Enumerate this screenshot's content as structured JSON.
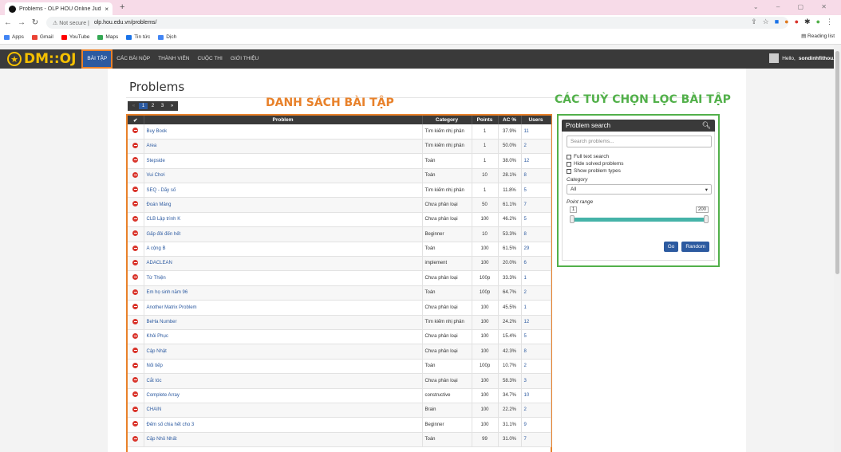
{
  "browser": {
    "tab_title": "Problems - OLP HOU Online Jud",
    "tab_close": "×",
    "new_tab": "+",
    "window_controls": "⌄ – ▢ ✕",
    "not_secure": "Not secure",
    "url": "olp.hou.edu.vn/problems/",
    "bookmarks": [
      "Apps",
      "Gmail",
      "YouTube",
      "Maps",
      "Tin tức",
      "Dịch"
    ],
    "bookmark_colors": [
      "#4285f4",
      "#ea4335",
      "#ff0000",
      "#34a853",
      "#1a73e8",
      "#4285f4"
    ],
    "reading_list": "Reading list"
  },
  "nav": {
    "logo": "DM::OJ",
    "items": [
      "BÀI TẬP",
      "CÁC BÀI NỘP",
      "THÀNH VIÊN",
      "CUỘC THI",
      "GIỚI THIỆU"
    ],
    "active_index": 0,
    "greeting": "Hello, ",
    "username": "sondinhfithou."
  },
  "page": {
    "title": "Problems",
    "pager": [
      "«",
      "1",
      "2",
      "3",
      "»"
    ],
    "annotation_list": "DANH SÁCH BÀI TẬP",
    "annotation_filter": "CÁC TUỲ CHỌN LỌC BÀI TẬP"
  },
  "table": {
    "headers": [
      "✔",
      "Problem",
      "Category",
      "Points",
      "AC %",
      "Users"
    ],
    "rows": [
      [
        "Buy Book",
        "Tìm kiếm nhị phân",
        "1",
        "37.9%",
        "11"
      ],
      [
        "Area",
        "Tìm kiếm nhị phân",
        "1",
        "50.0%",
        "2"
      ],
      [
        "Stepside",
        "Toán",
        "1",
        "38.0%",
        "12"
      ],
      [
        "Vui Chơi",
        "Toán",
        "10",
        "28.1%",
        "8"
      ],
      [
        "SEQ - Dãy số",
        "Tìm kiếm nhị phân",
        "1",
        "11.8%",
        "5"
      ],
      [
        "Đoán Mảng",
        "Chưa phân loại",
        "50",
        "61.1%",
        "7"
      ],
      [
        "CLB Lập trình K",
        "Chưa phân loại",
        "100",
        "46.2%",
        "5"
      ],
      [
        "Gấp đôi đến hết",
        "Beginner",
        "10",
        "53.3%",
        "8"
      ],
      [
        "A cộng B",
        "Toán",
        "100",
        "61.5%",
        "29"
      ],
      [
        "ADACLEAN",
        "implement",
        "100",
        "20.0%",
        "6"
      ],
      [
        "Từ Thiện",
        "Chưa phân loại",
        "100p",
        "33.3%",
        "1"
      ],
      [
        "Em họ sinh năm 96",
        "Toán",
        "100p",
        "64.7%",
        "2"
      ],
      [
        "Another Matrix Problem",
        "Chưa phân loại",
        "100",
        "45.5%",
        "1"
      ],
      [
        "BeHa Number",
        "Tìm kiếm nhị phân",
        "100",
        "24.2%",
        "12"
      ],
      [
        "Khôi Phục",
        "Chưa phân loại",
        "100",
        "15.4%",
        "5"
      ],
      [
        "Cập Nhật",
        "Chưa phân loại",
        "100",
        "42.3%",
        "8"
      ],
      [
        "Nối tiếp",
        "Toán",
        "100p",
        "10.7%",
        "2"
      ],
      [
        "Cắt tóc",
        "Chưa phân loại",
        "100",
        "58.3%",
        "3"
      ],
      [
        "Complete Array",
        "constructive",
        "100",
        "34.7%",
        "10"
      ],
      [
        "CHAIN",
        "Brain",
        "100",
        "22.2%",
        "2"
      ],
      [
        "Đếm số chia hết cho 3",
        "Beginner",
        "100",
        "31.1%",
        "9"
      ],
      [
        "Cặp Nhỏ Nhất",
        "Toán",
        "99",
        "31.0%",
        "7"
      ]
    ]
  },
  "search": {
    "title": "Problem search",
    "placeholder": "Search problems...",
    "checkboxes": [
      "Full text search",
      "Hide solved problems",
      "Show problem types"
    ],
    "category_label": "Category",
    "category_value": "All",
    "point_range_label": "Point range",
    "range_min": "1",
    "range_max": "200",
    "go": "Go",
    "random": "Random"
  }
}
